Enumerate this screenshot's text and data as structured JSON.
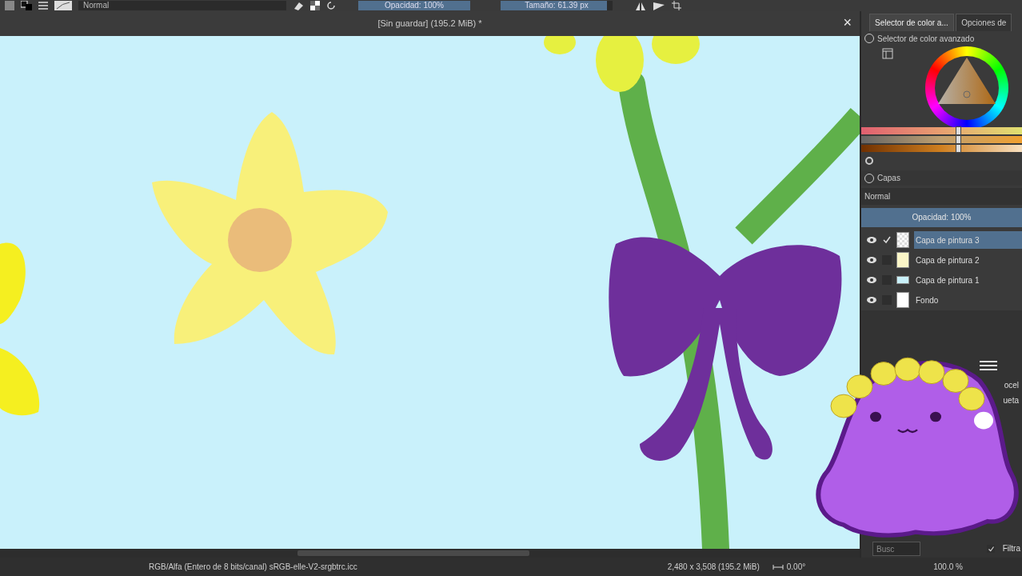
{
  "toolbar": {
    "blend_mode": "Normal",
    "opacity_slider": {
      "label": "Opacidad: 100%",
      "level": 1
    },
    "size_slider": {
      "label": "Tamaño: 61.39 px",
      "level": 0.95
    }
  },
  "color_sliders": [
    {
      "kind": "hue",
      "level": 0.6
    },
    {
      "kind": "saturation",
      "level": 0.6
    },
    {
      "kind": "value",
      "level": 0.6
    }
  ],
  "document": {
    "title": "[Sin guardar]  (195.2 MiB) *",
    "close": "×"
  },
  "docker": {
    "tabs": [
      {
        "label": "Selector de color a...",
        "selected": true
      },
      {
        "label": "Opciones de",
        "selected": false
      }
    ],
    "color_selector": {
      "title": "Selector de color avanzado"
    },
    "layers": {
      "title": "Capas",
      "blend_mode": "Normal",
      "opacity_slider": {
        "label": "Opacidad:  100%",
        "level": 1
      },
      "items": [
        {
          "name": "Capa de pintura 3",
          "selected": true,
          "visible": true,
          "kind": "transparent"
        },
        {
          "name": "Capa de pintura 2",
          "selected": false,
          "visible": true,
          "kind": "sketch"
        },
        {
          "name": "Capa de pintura 1",
          "selected": false,
          "visible": true,
          "kind": "fill"
        },
        {
          "name": "Fondo",
          "selected": false,
          "visible": true,
          "kind": "white"
        }
      ]
    },
    "brush_labels": [
      "ocel",
      "ueta"
    ],
    "search": {
      "placeholder": "Busc"
    },
    "filter": {
      "label": "Filtra",
      "checked": true
    }
  },
  "status_bar": {
    "color_space": "RGB/Alfa (Entero de 8 bits/canal)  sRGB-elle-V2-srgbtrc.icc",
    "dimensions": "2,480 x 3,508 (195.2 MiB)",
    "rotation": "0.00°",
    "zoom": "100.0 %"
  }
}
